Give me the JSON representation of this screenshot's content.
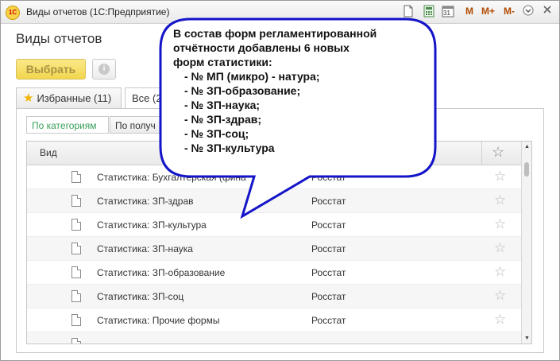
{
  "window": {
    "title": "Виды отчетов  (1С:Предприятие)",
    "logo": "1С",
    "toolbar_icons": [
      "document-icon",
      "calculator-icon",
      "calendar-icon"
    ],
    "calendar_label": "31",
    "memory_buttons": [
      "M",
      "M+",
      "M-"
    ]
  },
  "page": {
    "title": "Виды отчетов",
    "select_button": "Выбрать",
    "info_button": "i"
  },
  "tabs": [
    {
      "label": "Избранные (11)"
    },
    {
      "label": "Все (2"
    }
  ],
  "subtabs": [
    {
      "label": "По категориям"
    },
    {
      "label": "По получ"
    }
  ],
  "table": {
    "column_view": "Вид",
    "rows": [
      {
        "name": "Статистика: Бухгалтерская (фина",
        "org": "Росстат"
      },
      {
        "name": "Статистика: ЗП-здрав",
        "org": "Росстат"
      },
      {
        "name": "Статистика: ЗП-культура",
        "org": "Росстат"
      },
      {
        "name": "Статистика: ЗП-наука",
        "org": "Росстат"
      },
      {
        "name": "Статистика: ЗП-образование",
        "org": "Росстат"
      },
      {
        "name": "Статистика: ЗП-соц",
        "org": "Росстат"
      },
      {
        "name": "Статистика: Прочие формы",
        "org": "Росстат"
      }
    ]
  },
  "callout": {
    "lines": [
      "В состав форм регламентированной",
      "отчётности добавлены 6 новых",
      "форм статистики:"
    ],
    "items": [
      "- № МП (микро) - натура;",
      "- № ЗП-образование;",
      "- № ЗП-наука;",
      "- № ЗП-здрав;",
      "- № ЗП-соц;",
      "- № ЗП-культура"
    ],
    "fill": "#1414c8",
    "stroke": "#2b2b6b"
  }
}
